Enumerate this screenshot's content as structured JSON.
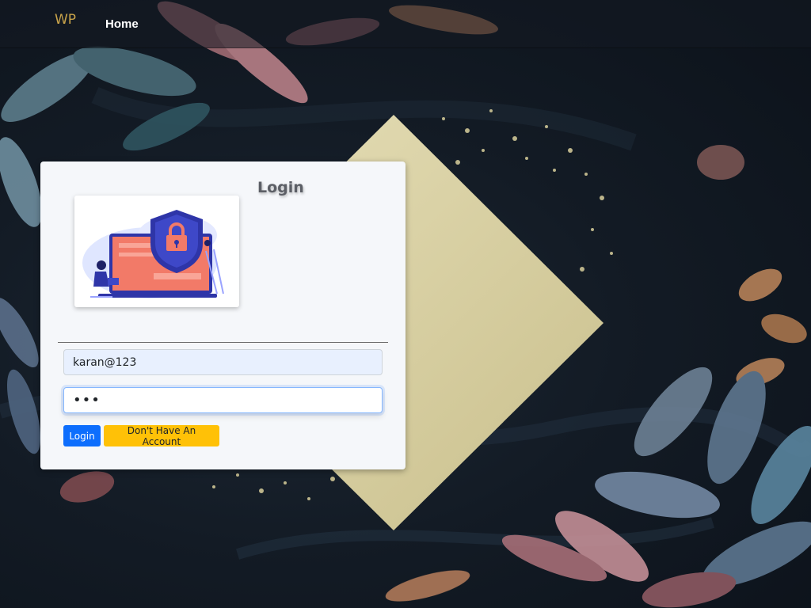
{
  "navbar": {
    "brand": "WP",
    "home_label": "Home"
  },
  "login_card": {
    "title": "Login",
    "illustration": "security-lock-laptop-illustration",
    "email_value": "karan@123",
    "password_value": "•••",
    "login_button": "Login",
    "register_button": "Don't Have An Account"
  },
  "colors": {
    "brand": "#c7a24a",
    "primary_button": "#0d6efd",
    "warning_button": "#ffc107",
    "card_background": "#f5f7fa",
    "page_background": "#131b25",
    "accent_diamond": "#d8cfa0"
  }
}
